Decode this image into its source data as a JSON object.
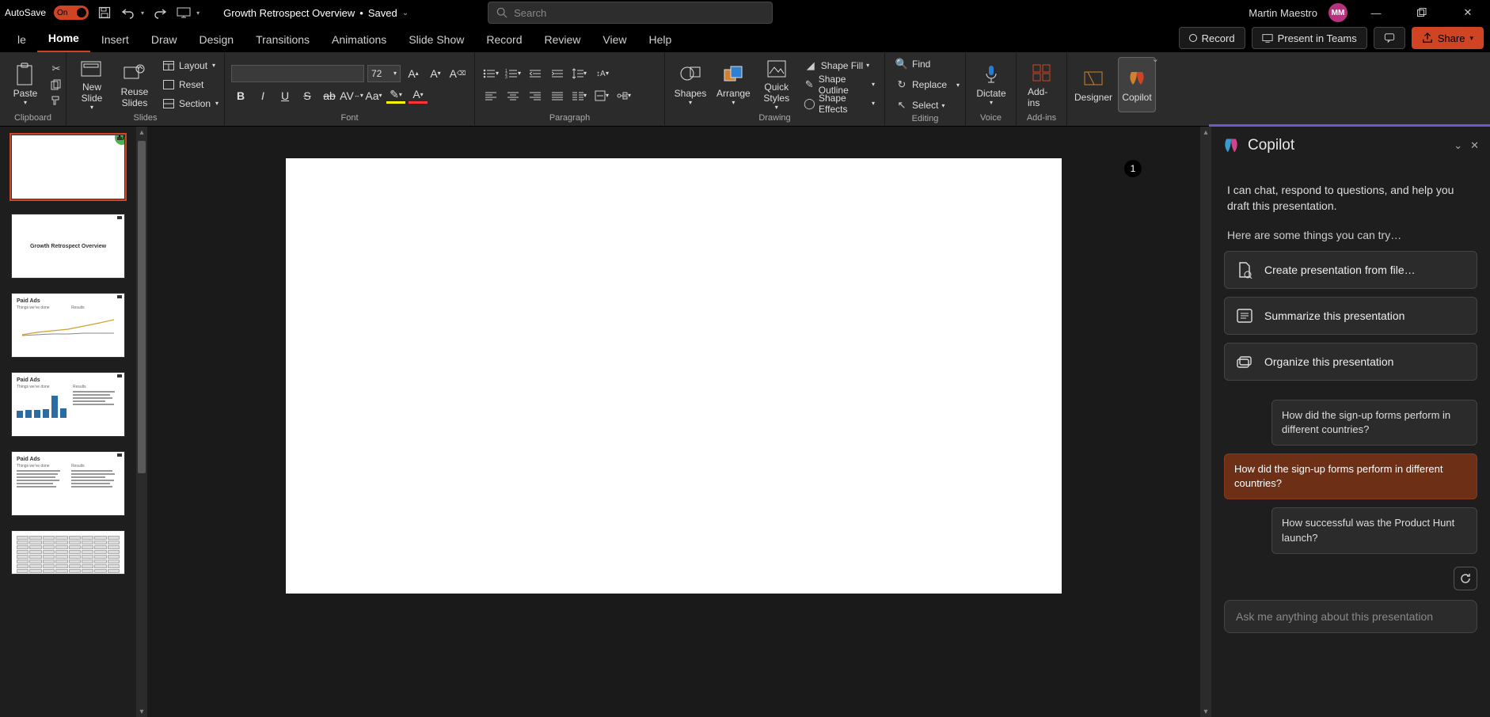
{
  "titlebar": {
    "autosave_label": "AutoSave",
    "autosave_state": "On",
    "doc_name": "Growth Retrospect Overview",
    "save_state": "Saved",
    "search_placeholder": "Search",
    "user_name": "Martin Maestro",
    "user_initials": "MM"
  },
  "tabs": {
    "items": [
      "le",
      "Home",
      "Insert",
      "Draw",
      "Design",
      "Transitions",
      "Animations",
      "Slide Show",
      "Record",
      "Review",
      "View",
      "Help"
    ],
    "active_index": 1,
    "record_btn": "Record",
    "present_btn": "Present in Teams",
    "share_btn": "Share"
  },
  "ribbon": {
    "clipboard": {
      "label": "Clipboard",
      "paste": "Paste"
    },
    "slides": {
      "label": "Slides",
      "new_slide": "New\nSlide",
      "reuse": "Reuse\nSlides",
      "layout": "Layout",
      "reset": "Reset",
      "section": "Section"
    },
    "font": {
      "label": "Font",
      "size": "72"
    },
    "paragraph": {
      "label": "Paragraph"
    },
    "drawing": {
      "label": "Drawing",
      "shapes": "Shapes",
      "arrange": "Arrange",
      "quick_styles": "Quick\nStyles",
      "shape_fill": "Shape Fill",
      "shape_outline": "Shape Outline",
      "shape_effects": "Shape Effects"
    },
    "editing": {
      "label": "Editing",
      "find": "Find",
      "replace": "Replace",
      "select": "Select"
    },
    "voice": {
      "label": "Voice",
      "dictate": "Dictate"
    },
    "addins": {
      "label": "Add-ins",
      "addins_btn": "Add-ins"
    },
    "designer": "Designer",
    "copilot": "Copilot"
  },
  "thumbnails": {
    "aa_badge": "AA",
    "slides": [
      {
        "kind": "blank"
      },
      {
        "kind": "title",
        "title": "Growth Retrospect Overview"
      },
      {
        "kind": "paid-line",
        "heading": "Paid Ads",
        "sub": "Things we've done",
        "right": "Results"
      },
      {
        "kind": "paid-bars",
        "heading": "Paid Ads",
        "sub": "Things we've done",
        "right": "Results"
      },
      {
        "kind": "paid-text",
        "heading": "Paid Ads",
        "sub": "Things we've done",
        "right": "Results"
      },
      {
        "kind": "table"
      }
    ]
  },
  "canvas": {
    "slide_number": "1"
  },
  "copilot": {
    "title": "Copilot",
    "intro": "I can chat, respond to questions, and help you draft this presentation.",
    "try_label": "Here are some things you can try…",
    "actions": [
      {
        "icon": "file-add",
        "label": "Create presentation from file…"
      },
      {
        "icon": "list",
        "label": "Summarize this presentation"
      },
      {
        "icon": "stack",
        "label": "Organize this presentation"
      }
    ],
    "suggestions": [
      {
        "text": "How did the sign-up forms perform in different countries?",
        "selected": false
      },
      {
        "text": "How did the sign-up forms perform in different countries?",
        "selected": true
      },
      {
        "text": "How successful was the Product Hunt launch?",
        "selected": false
      }
    ],
    "input_placeholder": "Ask me anything about this presentation"
  }
}
